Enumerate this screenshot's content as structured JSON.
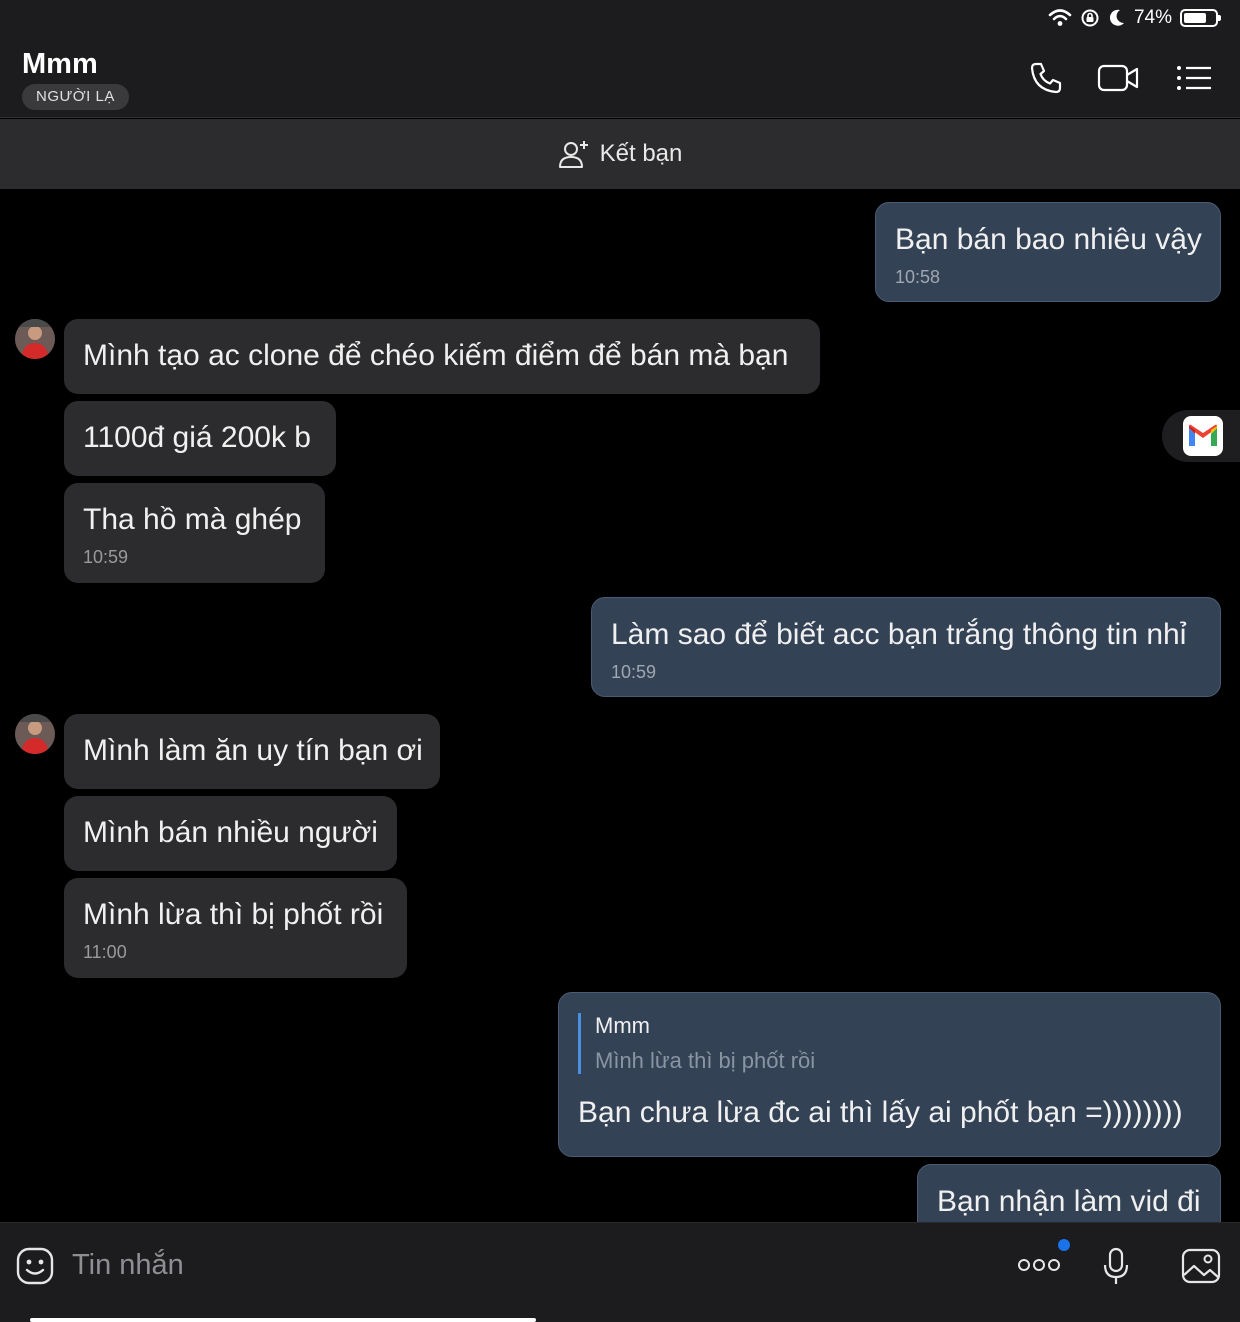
{
  "status_bar": {
    "battery": "74%",
    "battery_level": 0.74
  },
  "header": {
    "contact_name": "Mmm",
    "badge": "NGƯỜI LẠ",
    "icons": [
      "phone-icon",
      "video-call-icon",
      "menu-list-icon"
    ]
  },
  "friend_bar": {
    "label": "Kết bạn",
    "icon": "add-friend-icon"
  },
  "messages": [
    {
      "dir": "out",
      "text": "Bạn bán bao nhiêu vậy",
      "time": "10:58"
    },
    {
      "dir": "in",
      "text": "Mình tạo ac clone để chéo kiếm điểm để bán mà bạn"
    },
    {
      "dir": "in",
      "text": "1100đ giá 200k b"
    },
    {
      "dir": "in",
      "text": "Tha hồ mà ghép",
      "time": "10:59"
    },
    {
      "dir": "out",
      "text": "Làm sao để biết acc bạn trắng thông tin nhỉ",
      "time": "10:59"
    },
    {
      "dir": "in",
      "text": "Mình làm ăn uy tín bạn ơi"
    },
    {
      "dir": "in",
      "text": "Mình bán nhiều người"
    },
    {
      "dir": "in",
      "text": "Mình lừa thì bị phốt rồi",
      "time": "11:00"
    },
    {
      "dir": "out",
      "text": "Bạn chưa lừa đc ai thì lấy ai phốt bạn =))))))))",
      "reply_to": {
        "name": "Mmm",
        "text": "Mình lừa thì bị phốt rồi"
      }
    },
    {
      "dir": "out",
      "text": "Bạn nhận làm vid đi"
    }
  ],
  "input_bar": {
    "placeholder": "Tin nhắn",
    "icons": [
      "sticker-icon",
      "more-icon",
      "microphone-icon",
      "image-icon"
    ]
  },
  "floating": {
    "icon": "gmail-icon"
  }
}
